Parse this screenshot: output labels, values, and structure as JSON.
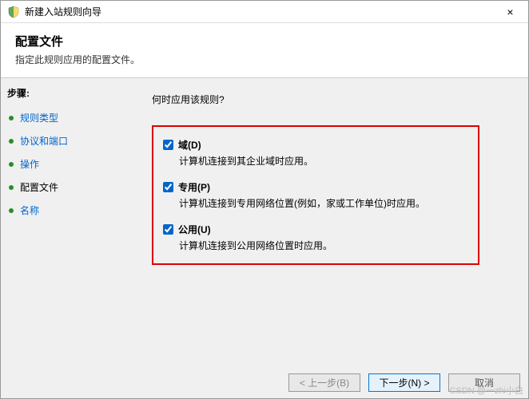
{
  "window": {
    "title": "新建入站规则向导",
    "close": "×"
  },
  "header": {
    "title": "配置文件",
    "subtitle": "指定此规则应用的配置文件。"
  },
  "sidebar": {
    "steps_label": "步骤:",
    "steps": [
      {
        "label": "规则类型",
        "active": false
      },
      {
        "label": "协议和端口",
        "active": false
      },
      {
        "label": "操作",
        "active": false
      },
      {
        "label": "配置文件",
        "active": true
      },
      {
        "label": "名称",
        "active": false
      }
    ]
  },
  "main": {
    "prompt": "何时应用该规则?",
    "options": [
      {
        "checked": true,
        "label": "域(D)",
        "desc": "计算机连接到其企业域时应用。"
      },
      {
        "checked": true,
        "label": "专用(P)",
        "desc": "计算机连接到专用网络位置(例如，家或工作单位)时应用。"
      },
      {
        "checked": true,
        "label": "公用(U)",
        "desc": "计算机连接到公用网络位置时应用。"
      }
    ]
  },
  "footer": {
    "back": "< 上一步(B)",
    "next": "下一步(N) >",
    "cancel": "取消"
  },
  "watermark": "CSDN @一zhi小白"
}
